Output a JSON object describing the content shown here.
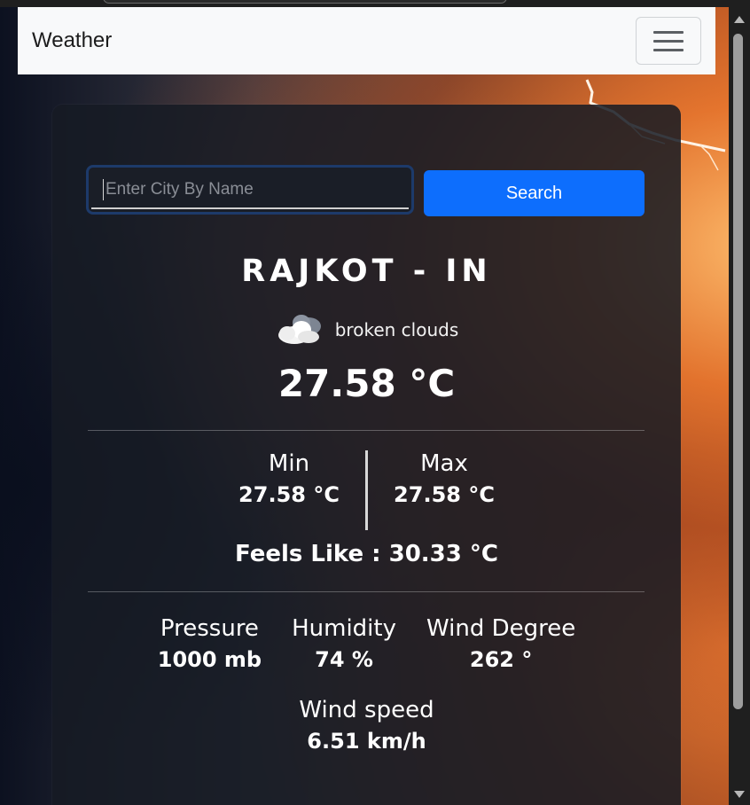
{
  "navbar": {
    "brand": "Weather"
  },
  "search": {
    "placeholder": "Enter City By Name",
    "button_label": "Search"
  },
  "weather": {
    "city": "RAJKOT - IN",
    "condition_icon": "broken-clouds-icon",
    "description": "broken clouds",
    "temperature": "27.58 °C",
    "min_label": "Min",
    "min_value": "27.58 °C",
    "max_label": "Max",
    "max_value": "27.58 °C",
    "feels_like": "Feels Like : 30.33 °C",
    "pressure_label": "Pressure",
    "pressure_value": "1000 mb",
    "humidity_label": "Humidity",
    "humidity_value": "74 %",
    "wind_degree_label": "Wind Degree",
    "wind_degree_value": "262 °",
    "wind_speed_label": "Wind speed",
    "wind_speed_value": "6.51 km/h"
  },
  "colors": {
    "primary_button": "#0d6efd",
    "navbar_bg": "#f8f9fa",
    "card_bg": "#161b24"
  }
}
